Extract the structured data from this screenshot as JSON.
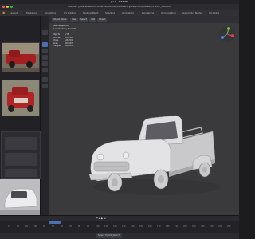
{
  "mac_menubar": {
    "time": "Jul 3 · 7:56 PM"
  },
  "window": {
    "title": "Blender [/Users/test/Documents/Blender/Models/Stylized/Compressed/Truck1_3.blend]"
  },
  "workspace_tabs": [
    {
      "label": "Layout",
      "active": false
    },
    {
      "label": "Modeling",
      "active": false
    },
    {
      "label": "Sculpting",
      "active": false
    },
    {
      "label": "UV Editing",
      "active": false
    },
    {
      "label": "Texture Paint",
      "active": false
    },
    {
      "label": "Shading",
      "active": false
    },
    {
      "label": "Animation",
      "active": false
    },
    {
      "label": "Rendering",
      "active": false
    },
    {
      "label": "Compositing",
      "active": false
    },
    {
      "label": "Geometry Nodes",
      "active": false
    },
    {
      "label": "Scripting",
      "active": false
    }
  ],
  "viewport": {
    "header_buttons": [
      "Object Mode",
      "View",
      "Select",
      "Add",
      "Object"
    ],
    "overlay": {
      "line1": "User Perspective",
      "line2": "(1) Collection | Truck FG"
    },
    "stats": [
      {
        "label": "Objects",
        "value": "1/18"
      },
      {
        "label": "Vertices",
        "value": "264,798"
      },
      {
        "label": "Edges",
        "value": "526,719"
      },
      {
        "label": "Faces",
        "value": "263,007"
      },
      {
        "label": "Triangles",
        "value": "526,014"
      }
    ],
    "gizmo_axes": [
      "X",
      "Y",
      "Z"
    ]
  },
  "timeline": {
    "ticks": [
      "0",
      "10",
      "20",
      "30",
      "40",
      "50",
      "60",
      "70",
      "80",
      "90",
      "100",
      "110",
      "120",
      "130",
      "140",
      "150",
      "160",
      "170",
      "180",
      "190",
      "200",
      "210",
      "220",
      "230",
      "240",
      "250"
    ]
  },
  "status_bar": {
    "scene_label": "Select Truck1_Sketch"
  },
  "colors": {
    "accent": "#4b6fb0",
    "viewport_bg": "#3a3a3d",
    "truck": "#d9d9dc"
  }
}
